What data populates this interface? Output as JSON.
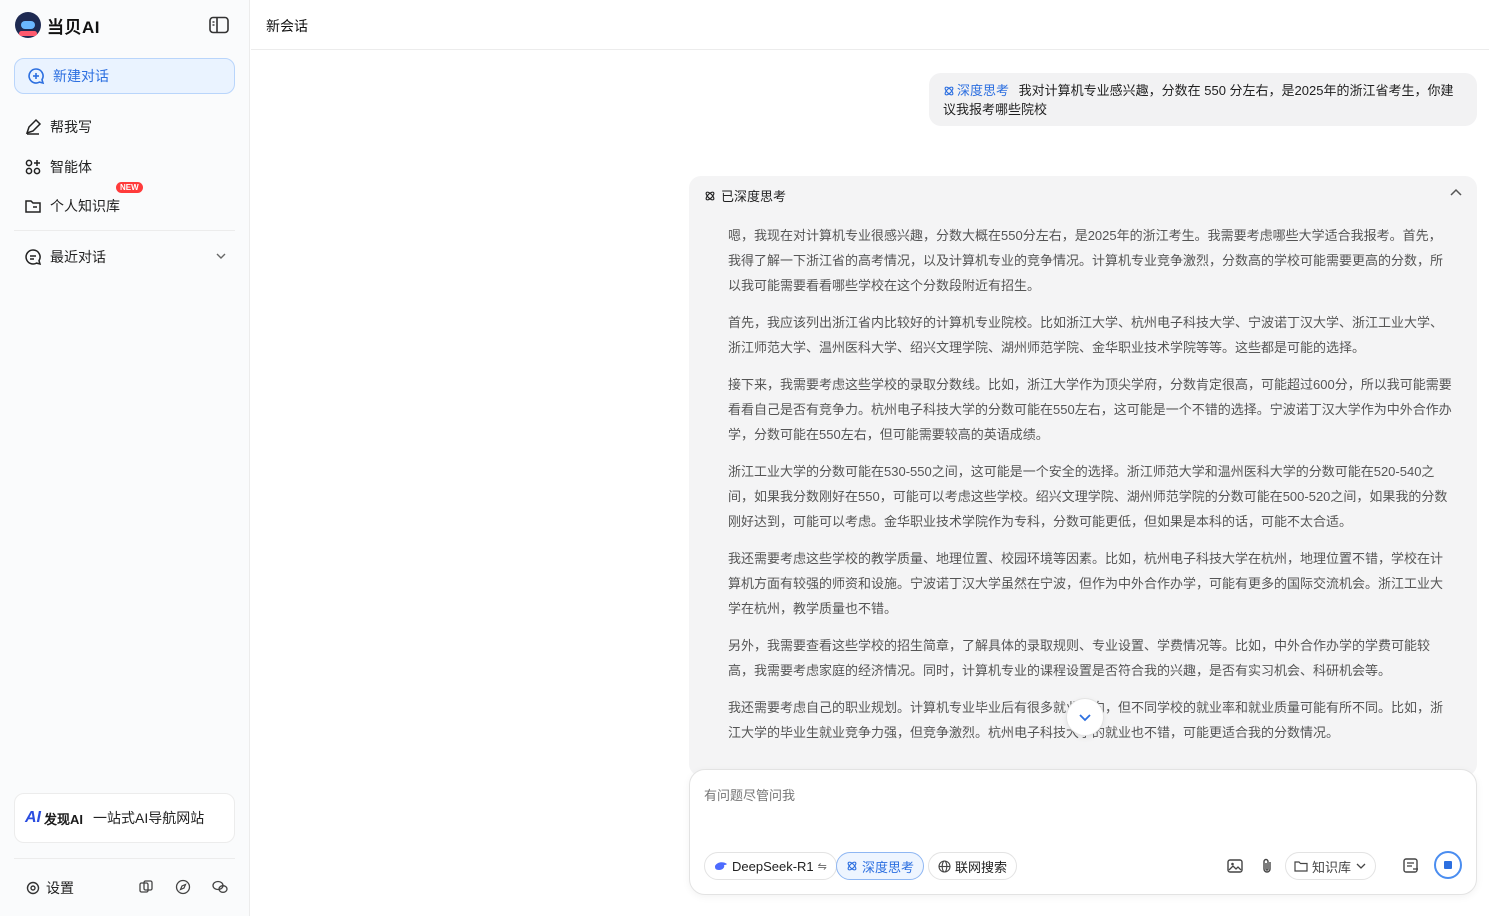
{
  "brand": {
    "name": "当贝AI"
  },
  "sidebar": {
    "new_chat": "新建对话",
    "items": [
      {
        "label": "帮我写",
        "icon": "pen-icon"
      },
      {
        "label": "智能体",
        "icon": "agents-icon"
      },
      {
        "label": "个人知识库",
        "icon": "knowledge-folder-icon",
        "badge": "NEW"
      }
    ],
    "recent": "最近对话",
    "promo": {
      "brand": "发现AI",
      "slogan": "一站式AI导航网站"
    },
    "settings": "设置"
  },
  "topbar": {
    "title": "新会话"
  },
  "user_message": {
    "tag": "深度思考",
    "text": "我对计算机专业感兴趣，分数在 550 分左右，是2025年的浙江省考生，你建议我报考哪些院校"
  },
  "thinking": {
    "header": "已深度思考",
    "paragraphs": [
      "嗯，我现在对计算机专业很感兴趣，分数大概在550分左右，是2025年的浙江考生。我需要考虑哪些大学适合我报考。首先，我得了解一下浙江省的高考情况，以及计算机专业的竞争情况。计算机专业竞争激烈，分数高的学校可能需要更高的分数，所以我可能需要看看哪些学校在这个分数段附近有招生。",
      "首先，我应该列出浙江省内比较好的计算机专业院校。比如浙江大学、杭州电子科技大学、宁波诺丁汉大学、浙江工业大学、浙江师范大学、温州医科大学、绍兴文理学院、湖州师范学院、金华职业技术学院等等。这些都是可能的选择。",
      "接下来，我需要考虑这些学校的录取分数线。比如，浙江大学作为顶尖学府，分数肯定很高，可能超过600分，所以我可能需要看看自己是否有竞争力。杭州电子科技大学的分数可能在550左右，这可能是一个不错的选择。宁波诺丁汉大学作为中外合作办学，分数可能在550左右，但可能需要较高的英语成绩。",
      "浙江工业大学的分数可能在530-550之间，这可能是一个安全的选择。浙江师范大学和温州医科大学的分数可能在520-540之间，如果我分数刚好在550，可能可以考虑这些学校。绍兴文理学院、湖州师范学院的分数可能在500-520之间，如果我的分数刚好达到，可能可以考虑。金华职业技术学院作为专科，分数可能更低，但如果是本科的话，可能不太合适。",
      "我还需要考虑这些学校的教学质量、地理位置、校园环境等因素。比如，杭州电子科技大学在杭州，地理位置不错，学校在计算机方面有较强的师资和设施。宁波诺丁汉大学虽然在宁波，但作为中外合作办学，可能有更多的国际交流机会。浙江工业大学在杭州，教学质量也不错。",
      "另外，我需要查看这些学校的招生简章，了解具体的录取规则、专业设置、学费情况等。比如，中外合作办学的学费可能较高，我需要考虑家庭的经济情况。同时，计算机专业的课程设置是否符合我的兴趣，是否有实习机会、科研机会等。",
      "我还需要考虑自己的职业规划。计算机专业毕业后有很多就业方向，但不同学校的就业率和就业质量可能有所不同。比如，浙江大学的毕业生就业竞争力强，但竞争激烈。杭州电子科技大学的就业也不错，可能更适合我的分数情况。"
    ]
  },
  "composer": {
    "placeholder": "有问题尽管问我",
    "model": "DeepSeek-R1",
    "deep_think": "深度思考",
    "web_search": "联网搜索",
    "knowledge": "知识库"
  },
  "colors": {
    "accent": "#2c6fe0",
    "badge": "#ff3b3b"
  }
}
